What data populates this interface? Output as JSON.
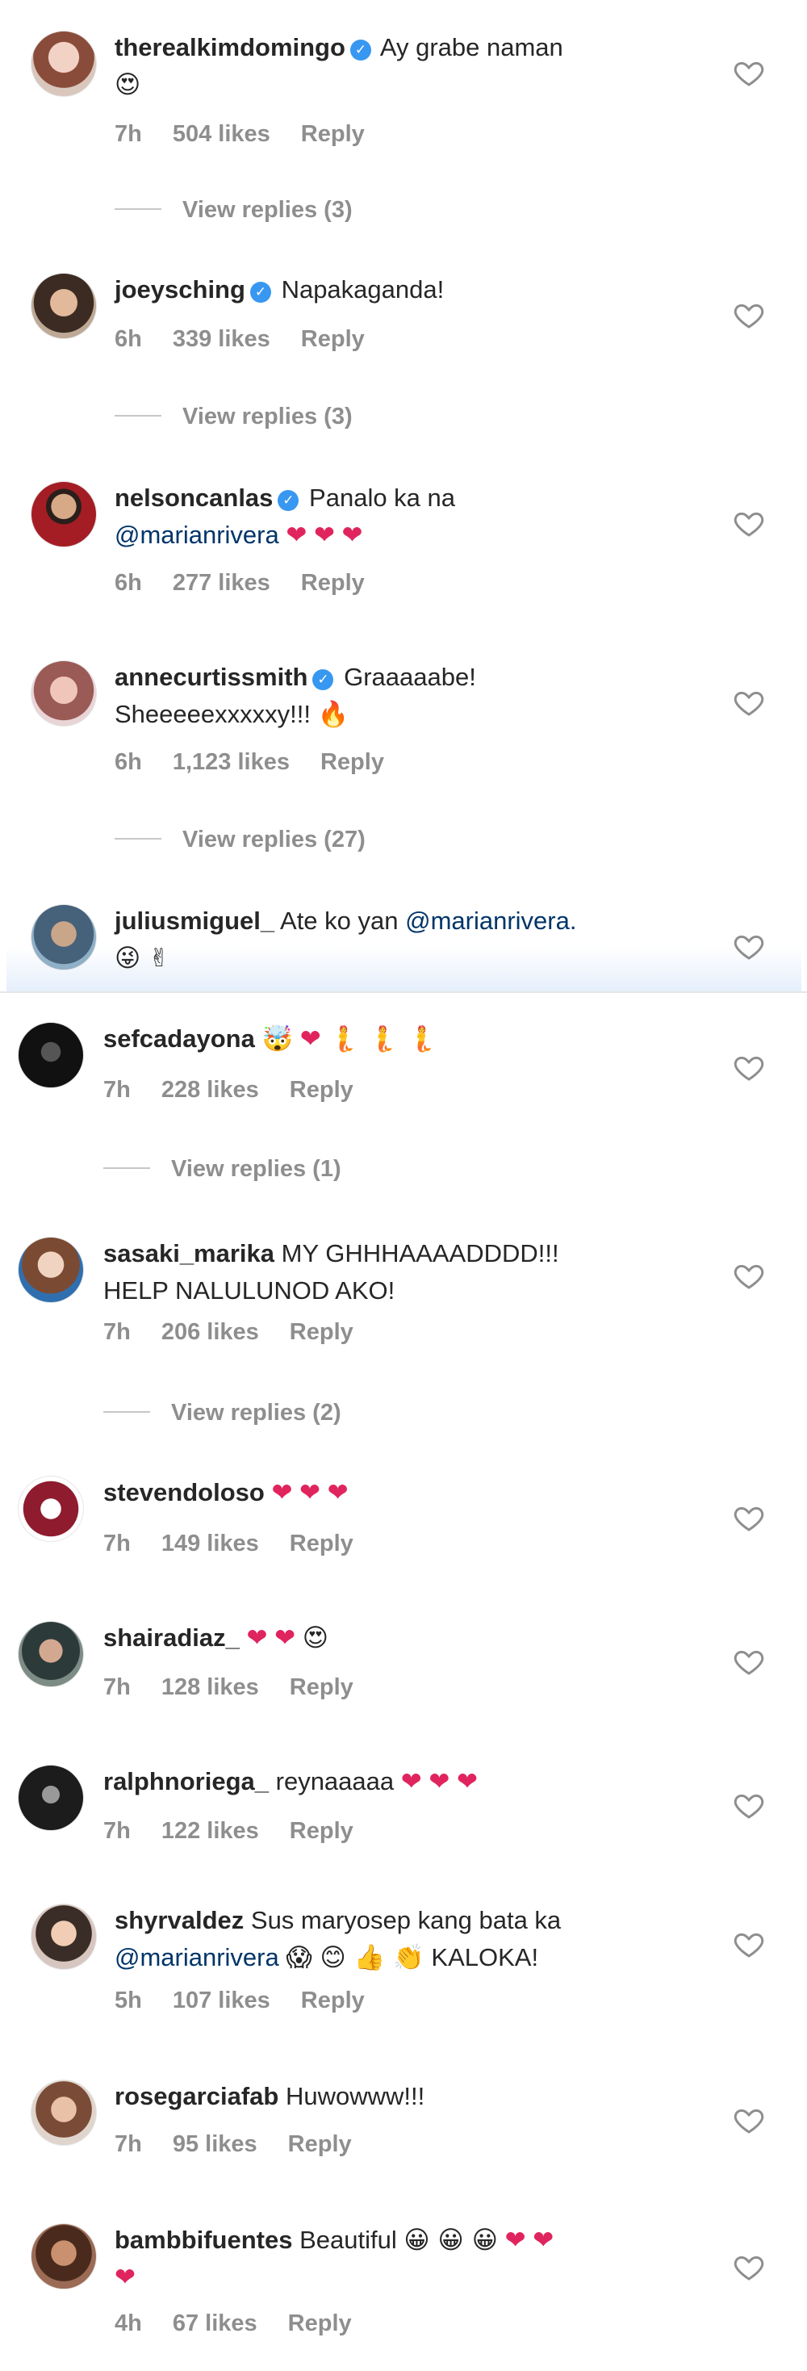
{
  "heart_color": "#e0245e",
  "mention_color": "#003569",
  "verified_color": "#3897f0",
  "comments": [
    {
      "user": "therealkimdomingo",
      "verified": true,
      "text": "Ay grabe naman",
      "emoji": "😍",
      "time": "7h",
      "likes": "504 likes",
      "reply": "Reply",
      "view_replies": "View replies (3)"
    },
    {
      "user": "joeysching",
      "verified": true,
      "text": "Napakaganda!",
      "time": "6h",
      "likes": "339 likes",
      "reply": "Reply",
      "view_replies": "View replies (3)"
    },
    {
      "user": "nelsoncanlas",
      "verified": true,
      "text": "Panalo ka na",
      "mention": "@marianrivera",
      "hearts": "❤ ❤ ❤",
      "time": "6h",
      "likes": "277 likes",
      "reply": "Reply"
    },
    {
      "user": "annecurtissmith",
      "verified": true,
      "text": "Graaaaabe!",
      "text2": "Sheeeeexxxxxy!!!",
      "emoji": "🔥",
      "time": "6h",
      "likes": "1,123 likes",
      "reply": "Reply",
      "view_replies": "View replies (27)"
    },
    {
      "user": "juliusmiguel_",
      "verified": false,
      "text": "Ate ko yan",
      "mention": "@marianrivera.",
      "emoji": "😜 ✌"
    },
    {
      "user": "sefcadayona",
      "verified": false,
      "emoji": "🤯",
      "hearts": "❤",
      "emoji2": "🧜 🧜 🧜",
      "time": "7h",
      "likes": "228 likes",
      "reply": "Reply",
      "view_replies": "View replies (1)"
    },
    {
      "user": "sasaki_marika",
      "verified": false,
      "text": "MY GHHHAAAADDDD!!!",
      "text2": "HELP NALULUNOD AKO!",
      "time": "7h",
      "likes": "206 likes",
      "reply": "Reply",
      "view_replies": "View replies (2)"
    },
    {
      "user": "stevendoloso",
      "verified": false,
      "hearts": "❤ ❤ ❤",
      "time": "7h",
      "likes": "149 likes",
      "reply": "Reply"
    },
    {
      "user": "shairadiaz_",
      "verified": false,
      "hearts": "❤ ❤",
      "emoji": "😍",
      "time": "7h",
      "likes": "128 likes",
      "reply": "Reply"
    },
    {
      "user": "ralphnoriega_",
      "verified": false,
      "text": "reynaaaaa",
      "hearts": "❤ ❤ ❤",
      "time": "7h",
      "likes": "122 likes",
      "reply": "Reply"
    },
    {
      "user": "shyrvaldez",
      "verified": false,
      "text": "Sus maryosep kang bata ka",
      "mention": "@marianrivera",
      "emoji": "😱 😊 👍 👏",
      "text2": "KALOKA!",
      "time": "5h",
      "likes": "107 likes",
      "reply": "Reply"
    },
    {
      "user": "rosegarciafab",
      "verified": false,
      "text": "Huwowww!!!",
      "time": "7h",
      "likes": "95 likes",
      "reply": "Reply"
    },
    {
      "user": "bambbifuentes",
      "verified": false,
      "text": "Beautiful",
      "emoji": "😀 😀 😀",
      "hearts": "❤ ❤",
      "hearts2": "❤",
      "time": "4h",
      "likes": "67 likes",
      "reply": "Reply"
    }
  ]
}
